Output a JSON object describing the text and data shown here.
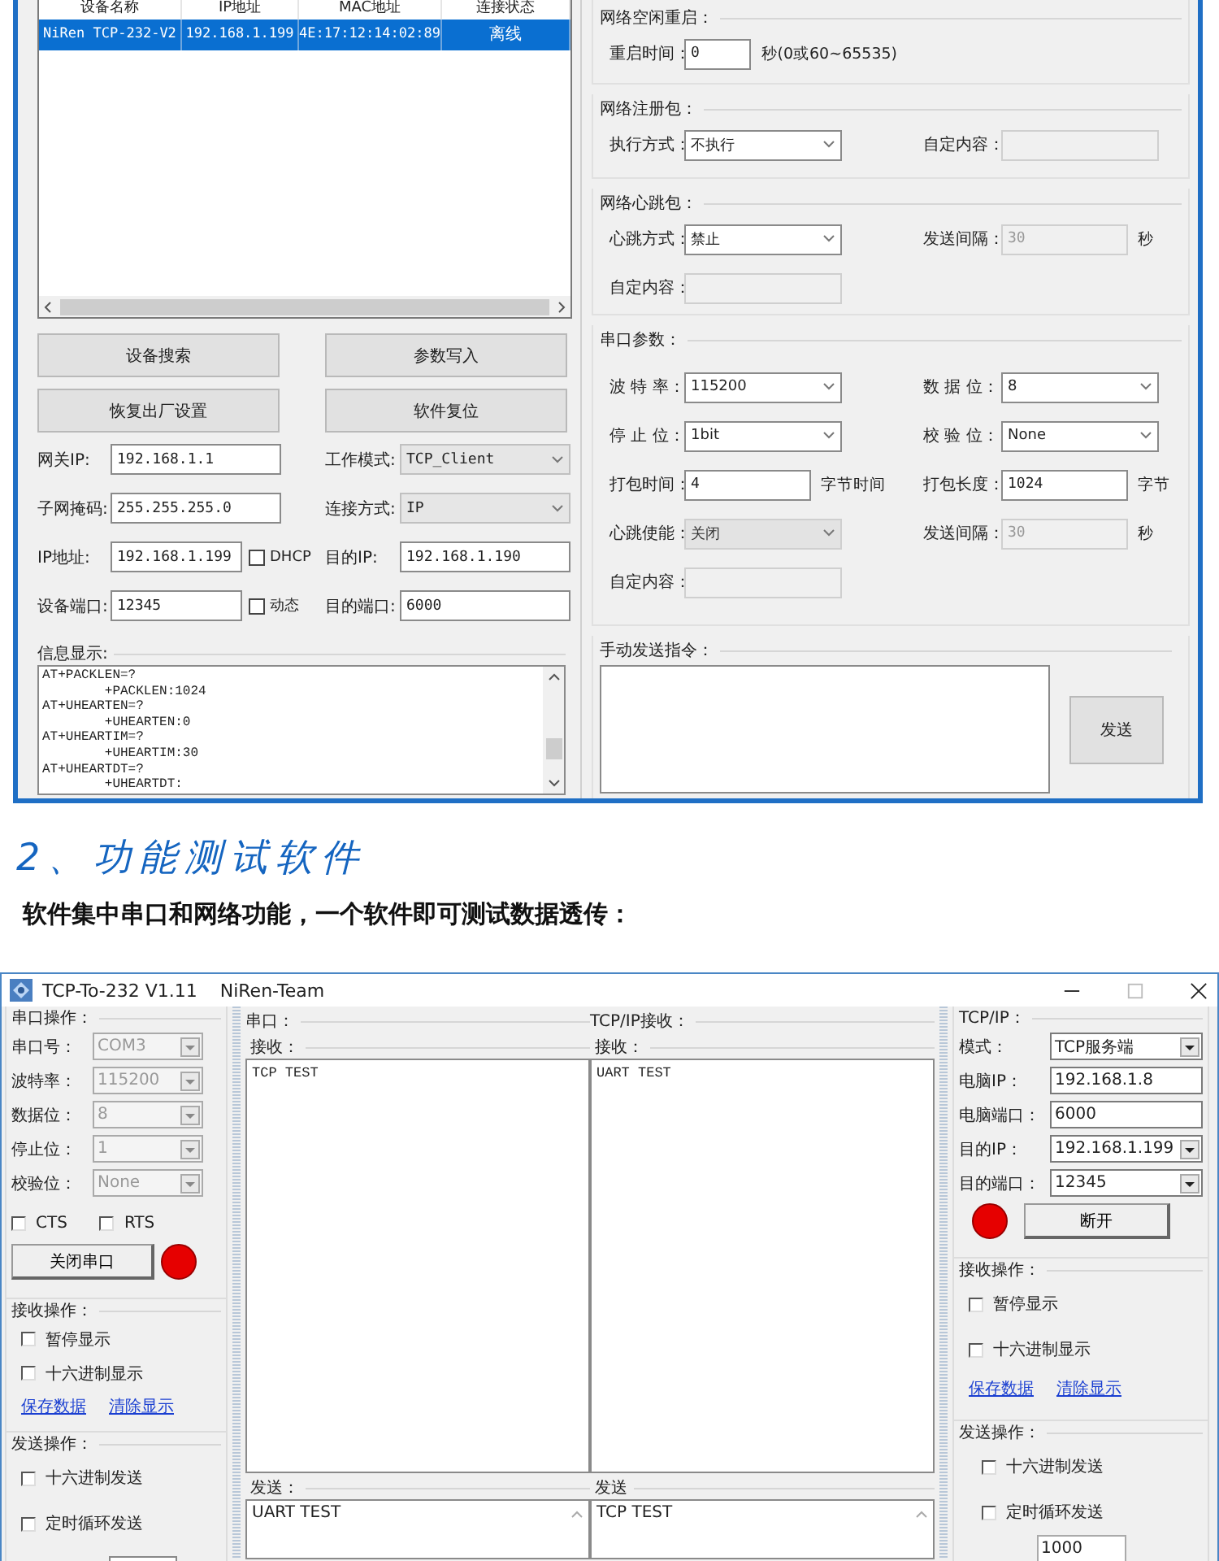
{
  "config_tool": {
    "device_table": {
      "columns": [
        "设备名称",
        "IP地址",
        "MAC地址",
        "连接状态"
      ],
      "rows": [
        {
          "cells": [
            "NiRen TCP-232-V2",
            "192.168.1.199",
            "4E:17:12:14:02:89",
            "离线"
          ],
          "selected": true
        }
      ]
    },
    "buttons": [
      "设备搜索",
      "参数写入",
      "恢复出厂设置",
      "软件复位"
    ],
    "network_fields": [
      {
        "label": "网关IP:",
        "kind": "input",
        "value": "192.168.1.1"
      },
      {
        "label": "工作模式:",
        "kind": "select",
        "value": "TCP_Client"
      },
      {
        "label": "子网掩码:",
        "kind": "input",
        "value": "255.255.255.0"
      },
      {
        "label": "连接方式:",
        "kind": "select",
        "value": "IP"
      },
      {
        "label": "IP地址:",
        "kind": "input",
        "value": "192.168.1.199",
        "option": {
          "label": "DHCP",
          "checked": false
        }
      },
      {
        "label": "目的IP:",
        "kind": "input",
        "value": "192.168.1.190"
      },
      {
        "label": "设备端口:",
        "kind": "input",
        "value": "12345",
        "option": {
          "label": "动态",
          "checked": false
        }
      },
      {
        "label": "目的端口:",
        "kind": "input",
        "value": "6000"
      }
    ],
    "info_display": {
      "title": "信息显示:",
      "lines": [
        "AT+PACKLEN=?",
        "        +PACKLEN:1024",
        "AT+UHEARTEN=?",
        "        +UHEARTEN:0",
        "AT+UHEARTIM=?",
        "        +UHEARTIM:30",
        "AT+UHEARTDT=?",
        "        +UHEARTDT:"
      ]
    },
    "right_groups": [
      {
        "title": "网络空闲重启：",
        "fields": [
          {
            "label": "重启时间：",
            "kind": "input",
            "value": "0",
            "unit": "秒(0或60~65535)",
            "disabled": false
          }
        ]
      },
      {
        "title": "网络注册包：",
        "fields": [
          {
            "label": "执行方式：",
            "kind": "select",
            "value": "不执行",
            "disabled": false
          },
          {
            "label": "自定内容：",
            "kind": "input",
            "disabled": true
          }
        ]
      },
      {
        "title": "网络心跳包：",
        "fields": [
          {
            "label": "心跳方式：",
            "kind": "select",
            "value": "禁止",
            "disabled": false
          },
          {
            "label": "发送间隔：",
            "kind": "input",
            "value": "30",
            "unit": "秒",
            "disabled": true
          },
          {
            "label": "自定内容：",
            "kind": "input",
            "disabled": true
          }
        ]
      },
      {
        "title": "串口参数：",
        "fields": [
          {
            "label": "波 特 率：",
            "kind": "select",
            "value": "115200",
            "disabled": false
          },
          {
            "label": "数 据 位：",
            "kind": "select",
            "value": "8",
            "disabled": false
          },
          {
            "label": "停 止 位：",
            "kind": "select",
            "value": "1bit",
            "disabled": false
          },
          {
            "label": "校 验 位：",
            "kind": "select",
            "value": "None",
            "disabled": false
          },
          {
            "label": "打包时间：",
            "kind": "input",
            "value": "4",
            "unit": "字节时间",
            "disabled": false
          },
          {
            "label": "打包长度：",
            "kind": "input",
            "value": "1024",
            "unit": "字节",
            "disabled": false
          },
          {
            "label": "心跳使能：",
            "kind": "select",
            "value": "关闭",
            "disabled": true
          },
          {
            "label": "发送间隔：",
            "kind": "input",
            "value": "30",
            "unit": "秒",
            "disabled": true
          },
          {
            "label": "自定内容：",
            "kind": "input",
            "disabled": true
          }
        ]
      }
    ],
    "manual_send": {
      "title": "手动发送指令：",
      "button": "发送"
    }
  },
  "section_heading": "2、功能测试软件",
  "section_intro": "软件集中串口和网络功能，一个软件即可测试数据透传：",
  "test_tool": {
    "title": "TCP-To-232 V1.11",
    "team": "NiRen-Team",
    "serial_ops": {
      "title": "串口操作：",
      "fields": [
        {
          "label": "串口号：",
          "value": "COM3",
          "disabled": true
        },
        {
          "label": "波特率：",
          "value": "115200",
          "disabled": true
        },
        {
          "label": "数据位：",
          "value": "8",
          "disabled": true
        },
        {
          "label": "停止位：",
          "value": "1",
          "disabled": true
        },
        {
          "label": "校验位：",
          "value": "None",
          "disabled": true
        }
      ],
      "checks": [
        {
          "label": "CTS",
          "checked": false
        },
        {
          "label": "RTS",
          "checked": false
        }
      ],
      "button": "关闭串口"
    },
    "receive_ops": {
      "title": "接收操作：",
      "checks": [
        {
          "label": "暂停显示",
          "checked": false
        },
        {
          "label": "十六进制显示",
          "checked": false
        }
      ],
      "links": [
        "保存数据",
        "清除显示"
      ]
    },
    "send_ops": {
      "title": "发送操作：",
      "checks": [
        {
          "label": "十六进制发送",
          "checked": false
        },
        {
          "label": "定时循环发送",
          "checked": false
        }
      ]
    },
    "serial_panel": {
      "title": "串口：",
      "receive_title": "接收：",
      "received": "TCP TEST",
      "send_title": "发送：",
      "sent": "UART TEST"
    },
    "tcp_panel": {
      "title": "TCP/IP接收：",
      "receive_title": "接收：",
      "received": "UART TEST",
      "send_title": "发送",
      "sent": "TCP TEST"
    },
    "tcp_settings": {
      "title": "TCP/IP：",
      "fields": [
        {
          "label": "模式：",
          "kind": "select",
          "value": "TCP服务端"
        },
        {
          "label": "电脑IP：",
          "kind": "input",
          "value": "192.168.1.8"
        },
        {
          "label": "电脑端口：",
          "kind": "input",
          "value": "6000"
        },
        {
          "label": "目的IP：",
          "kind": "select",
          "value": "192.168.1.199"
        },
        {
          "label": "目的端口：",
          "kind": "select",
          "value": "12345"
        }
      ],
      "button": "断开"
    },
    "tcp_receive_ops": {
      "title": "接收操作：",
      "checks": [
        {
          "label": "暂停显示",
          "checked": false
        },
        {
          "label": "十六进制显示",
          "checked": false
        }
      ],
      "links": [
        "保存数据",
        "清除显示"
      ]
    },
    "tcp_send_ops": {
      "title": "发送操作：",
      "checks": [
        {
          "label": "十六进制发送",
          "checked": false
        },
        {
          "label": "定时循环发送",
          "checked": false
        }
      ],
      "interval": "1000"
    }
  }
}
